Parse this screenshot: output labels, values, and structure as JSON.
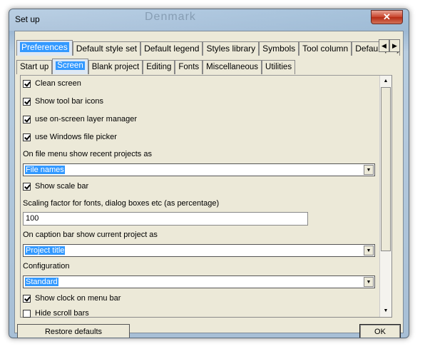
{
  "window": {
    "title": "Set up",
    "close_glyph": "✕",
    "background_text": "Denmark"
  },
  "main_tabs": [
    {
      "label": "Preferences",
      "selected": true
    },
    {
      "label": "Default style set",
      "selected": false
    },
    {
      "label": "Default legend",
      "selected": false
    },
    {
      "label": "Styles library",
      "selected": false
    },
    {
      "label": "Symbols",
      "selected": false
    },
    {
      "label": "Tool column",
      "selected": false
    },
    {
      "label": "Default proje",
      "selected": false
    }
  ],
  "tab_scroll": {
    "left": "◀",
    "right": "▶"
  },
  "sub_tabs": [
    {
      "label": "Start up",
      "selected": false
    },
    {
      "label": "Screen",
      "selected": true
    },
    {
      "label": "Blank project",
      "selected": false
    },
    {
      "label": "Editing",
      "selected": false
    },
    {
      "label": "Fonts",
      "selected": false
    },
    {
      "label": "Miscellaneous",
      "selected": false
    },
    {
      "label": "Utilities",
      "selected": false
    }
  ],
  "options": {
    "clean_screen": {
      "label": "Clean screen",
      "checked": true
    },
    "show_toolbar_icons": {
      "label": "Show tool bar icons",
      "checked": true
    },
    "layer_manager": {
      "label": "use on-screen layer manager",
      "checked": true
    },
    "windows_picker": {
      "label": "use Windows file picker",
      "checked": true
    },
    "recent_projects_label": "On file menu show recent projects as",
    "recent_projects_value": "File names",
    "show_scale_bar": {
      "label": "Show scale bar",
      "checked": true
    },
    "scaling_label": "Scaling factor for fonts, dialog boxes etc (as percentage)",
    "scaling_value": "100",
    "caption_label": "On caption bar show current project as",
    "caption_value": "Project title",
    "configuration_label": "Configuration",
    "configuration_value": "Standard",
    "show_clock": {
      "label": "Show clock on menu bar",
      "checked": true
    },
    "hide_scroll_bars": {
      "label": "Hide scroll bars",
      "checked": false
    }
  },
  "scrollbar": {
    "up": "▲",
    "down": "▼"
  },
  "dropdown_glyph": "▼",
  "buttons": {
    "restore_defaults": "Restore defaults",
    "ok": "OK"
  }
}
